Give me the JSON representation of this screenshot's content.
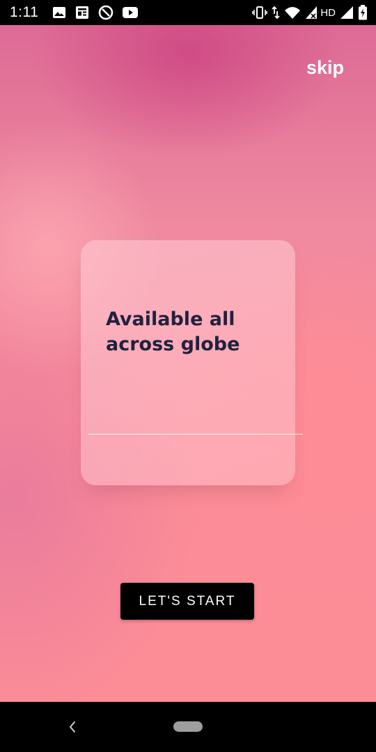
{
  "status_bar": {
    "time": "1:11",
    "left_icons": [
      "image-icon",
      "news-icon",
      "at-sign-icon",
      "youtube-icon"
    ],
    "right_icons": [
      "vibrate-icon",
      "data-arrows-icon",
      "wifi-icon",
      "signal-x-icon",
      "signal-icon",
      "battery-charging-icon"
    ],
    "network_label": "HD"
  },
  "header": {
    "skip_label": "skip"
  },
  "card": {
    "title": "Available all across globe"
  },
  "actions": {
    "start_label": "LET'S START"
  },
  "nav_bar": {
    "icons": [
      "back-icon",
      "home-pill-icon"
    ]
  },
  "colors": {
    "button_bg": "#000000",
    "title_text": "#22213f",
    "skip_text": "#ffffff"
  }
}
